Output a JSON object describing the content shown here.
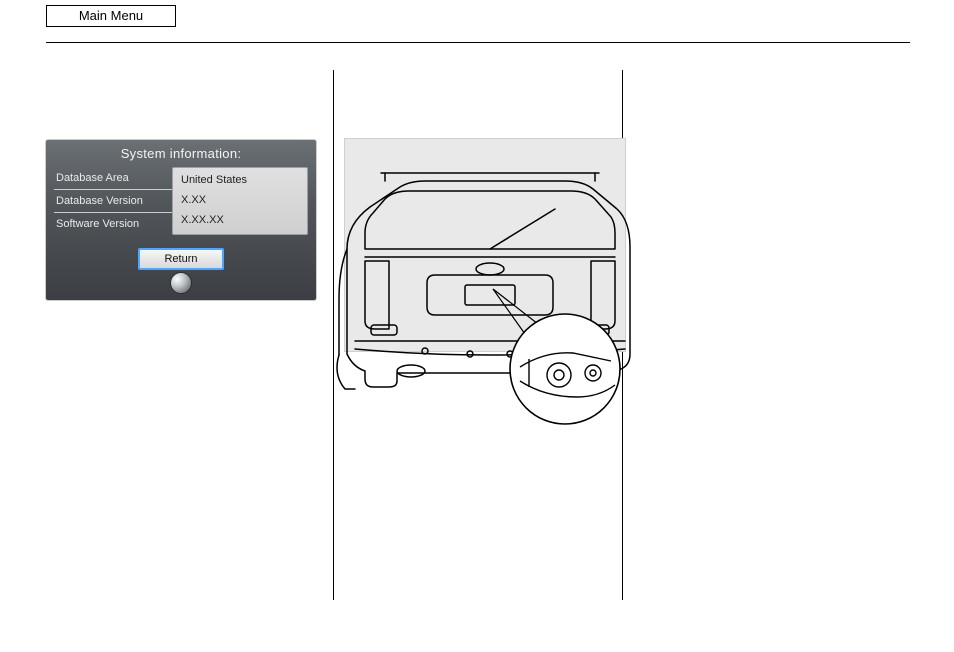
{
  "header": {
    "main_menu_label": "Main Menu"
  },
  "sysinfo": {
    "title": "System information:",
    "rows": [
      {
        "label": "Database Area",
        "value": "United States"
      },
      {
        "label": "Database Version",
        "value": "X.XX"
      },
      {
        "label": "Software Version",
        "value": "X.XX.XX"
      }
    ],
    "return_label": "Return"
  }
}
